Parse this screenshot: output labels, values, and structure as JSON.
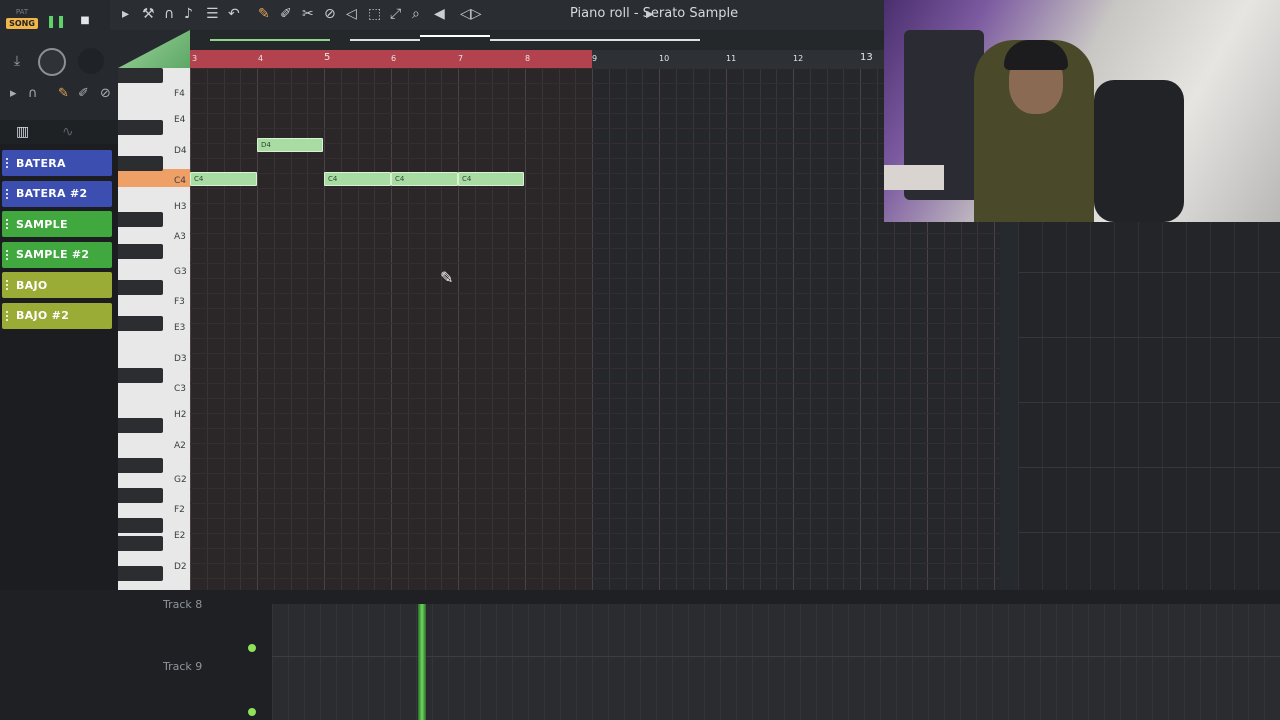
{
  "transport": {
    "pat_label": "PAT",
    "song_label": "SONG"
  },
  "toolbar": {
    "title": "Piano roll - Serato Sample"
  },
  "channels": [
    {
      "label": "BATERA",
      "color": "#3c4fb0"
    },
    {
      "label": "BATERA #2",
      "color": "#3c4fb0"
    },
    {
      "label": "SAMPLE",
      "color": "#41a83f"
    },
    {
      "label": "SAMPLE #2",
      "color": "#41a83f"
    },
    {
      "label": "BAJO",
      "color": "#9aab36"
    },
    {
      "label": "BAJO #2",
      "color": "#9aab36"
    }
  ],
  "ruler": {
    "numbers": [
      "3",
      "4",
      "5",
      "6",
      "7",
      "8",
      "9",
      "10",
      "11",
      "12",
      "13"
    ]
  },
  "keys": [
    "F4",
    "E4",
    "D4",
    "C4",
    "H3",
    "A3",
    "G3",
    "F3",
    "E3",
    "D3",
    "C3",
    "H2",
    "A2",
    "G2",
    "F2",
    "E2",
    "D2"
  ],
  "notes": [
    {
      "label": "D4"
    },
    {
      "label": "C4"
    },
    {
      "label": "C4"
    },
    {
      "label": "C4"
    },
    {
      "label": "C4"
    }
  ],
  "tracks": [
    {
      "label": "Track 8"
    },
    {
      "label": "Track 9"
    }
  ]
}
